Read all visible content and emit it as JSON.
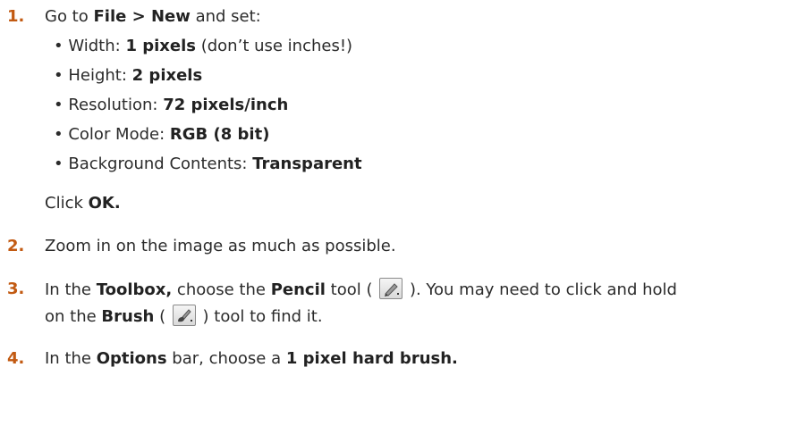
{
  "step1": {
    "num": "1.",
    "intro_pre": "Go to ",
    "intro_menu": "File > New",
    "intro_post": " and set:",
    "settings": [
      {
        "bullet": "• ",
        "label": "Width: ",
        "value": "1 pixels",
        "note": " (don’t use inches!)"
      },
      {
        "bullet": "• ",
        "label": "Height: ",
        "value": "2 pixels",
        "note": ""
      },
      {
        "bullet": "• ",
        "label": "Resolution: ",
        "value": "72 pixels/inch",
        "note": ""
      },
      {
        "bullet": "• ",
        "label": "Color Mode: ",
        "value": "RGB (8 bit)",
        "note": ""
      },
      {
        "bullet": "• ",
        "label": "Background Contents: ",
        "value": "Transparent",
        "note": ""
      }
    ],
    "click_pre": "Click ",
    "click_btn": "OK."
  },
  "step2": {
    "num": "2.",
    "text": "Zoom in on the image as much as possible."
  },
  "step3": {
    "num": "3.",
    "t1": "In the ",
    "toolbox": "Toolbox,",
    "t2": " choose the ",
    "pencil": "Pencil",
    "t3": " tool ( ",
    "t4": " ). You may need to click and hold",
    "t5": "on the ",
    "brush": "Brush",
    "t6": " ( ",
    "t7": " ) tool to find it.",
    "pencil_icon": "pencil-icon",
    "brush_icon": "brush-icon"
  },
  "step4": {
    "num": "4.",
    "t1": "In the ",
    "options": "Options",
    "t2": " bar, choose a ",
    "brush": "1 pixel hard brush."
  },
  "colors": {
    "step_number": "#c25a12",
    "text": "#2b2b2b"
  }
}
